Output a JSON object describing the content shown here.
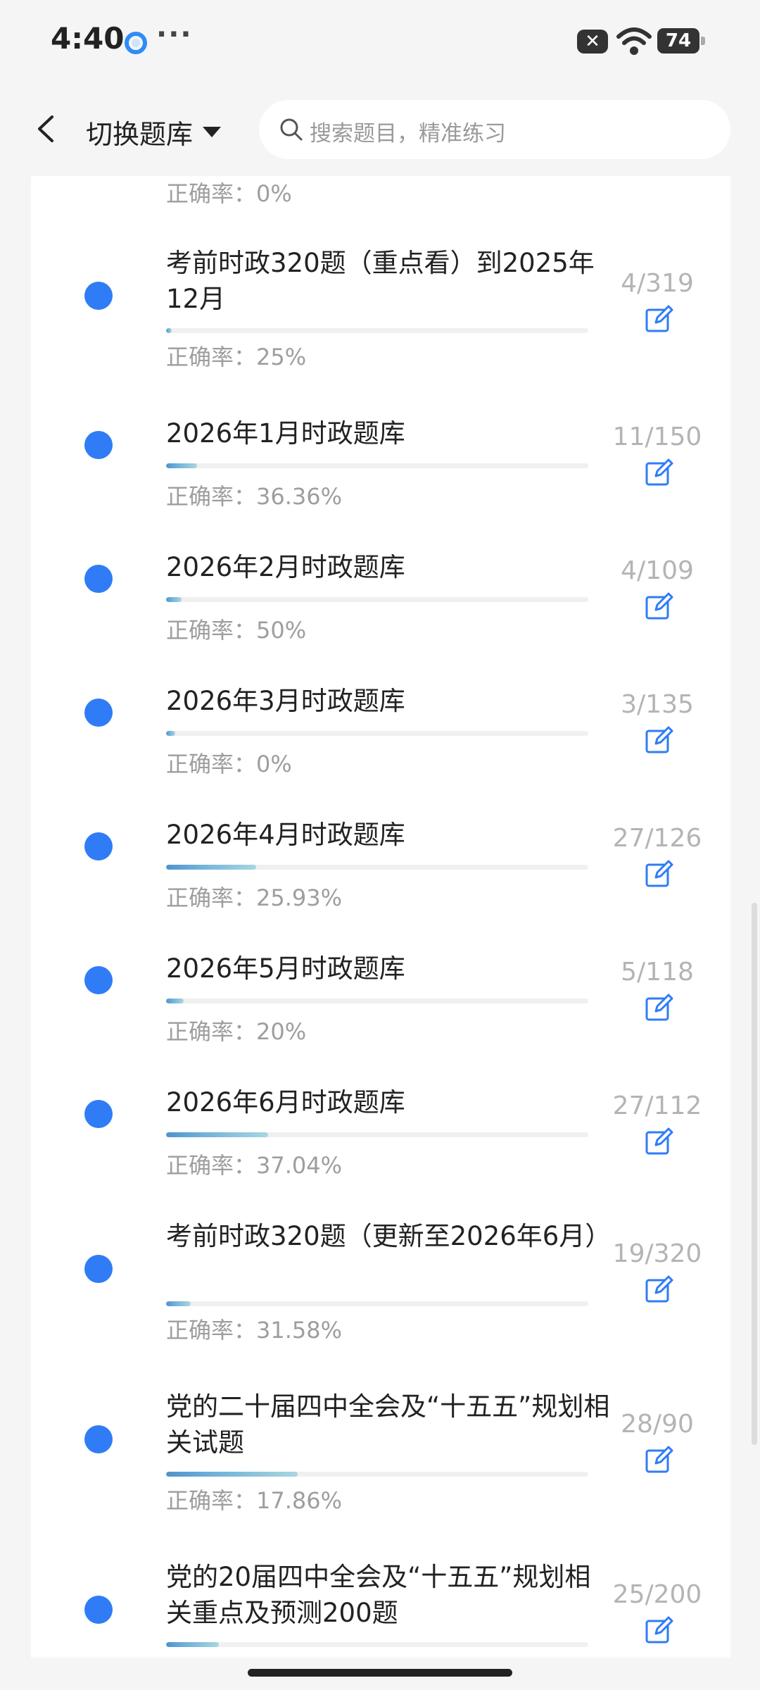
{
  "status_bar": {
    "time": "4:40",
    "dots": "···",
    "close_badge": "✕",
    "battery": "74"
  },
  "header": {
    "switch_label": "切换题库",
    "search_placeholder": "搜索题目，精准练习"
  },
  "partial_item": {
    "rate": "正确率：0%"
  },
  "items": [
    {
      "title": "考前时政320题（重点看）到2025年12月",
      "count": "4/319",
      "rate": "正确率：25%",
      "progress": 0.0125
    },
    {
      "title": "2026年1月时政题库",
      "count": "11/150",
      "rate": "正确率：36.36%",
      "progress": 0.073
    },
    {
      "title": "2026年2月时政题库",
      "count": "4/109",
      "rate": "正确率：50%",
      "progress": 0.037
    },
    {
      "title": "2026年3月时政题库",
      "count": "3/135",
      "rate": "正确率：0%",
      "progress": 0.022
    },
    {
      "title": "2026年4月时政题库",
      "count": "27/126",
      "rate": "正确率：25.93%",
      "progress": 0.214
    },
    {
      "title": "2026年5月时政题库",
      "count": "5/118",
      "rate": "正确率：20%",
      "progress": 0.042
    },
    {
      "title": "2026年6月时政题库",
      "count": "27/112",
      "rate": "正确率：37.04%",
      "progress": 0.241
    },
    {
      "title": "考前时政320题（更新至2026年6月）",
      "count": "19/320",
      "rate": "正确率：31.58%",
      "progress": 0.059
    },
    {
      "title": "党的二十届四中全会及“十五五”规划相关试题",
      "count": "28/90",
      "rate": "正确率：17.86%",
      "progress": 0.311
    },
    {
      "title": "党的20届四中全会及“十五五”规划相关重点及预测200题",
      "count": "25/200",
      "rate": "",
      "progress": 0.125
    }
  ],
  "colors": {
    "accent": "#2f7cf6",
    "progress_start": "#4f93cf",
    "progress_end": "#a9d6e1"
  },
  "icons": {
    "back": "chevron-left-icon",
    "search": "search-icon",
    "edit": "edit-icon"
  }
}
